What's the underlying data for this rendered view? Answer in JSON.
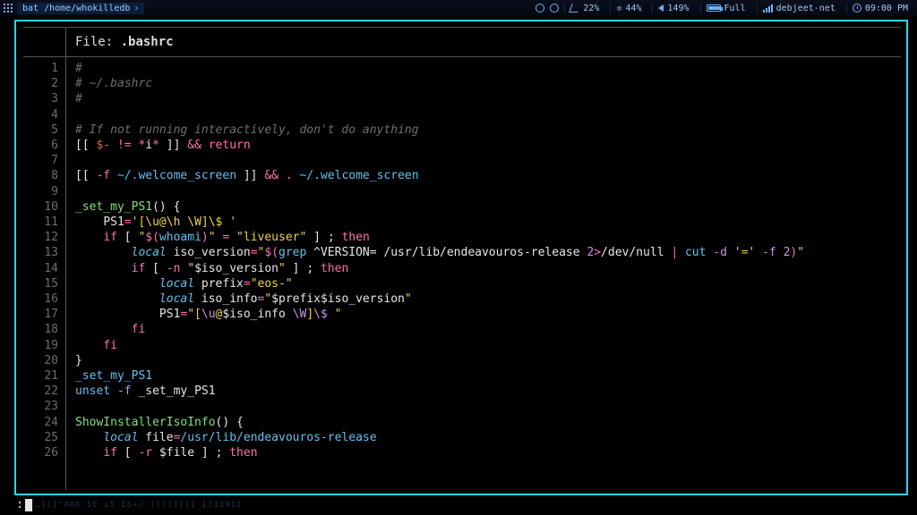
{
  "topbar": {
    "window_title": "bat /home/whokilledb",
    "cpu1": "22%",
    "cpu2": "44%",
    "volume": "149%",
    "battery_label": "Full",
    "battery_pct": 100,
    "network": "debjeet-net",
    "clock": "09:00 PM"
  },
  "viewer": {
    "file_label": "File:",
    "file_name": ".bashrc",
    "lines_start": 1,
    "lines_end": 26,
    "prompt_char": ":"
  },
  "code_lines": [
    {
      "n": 1,
      "segs": [
        [
          "#",
          "comment"
        ]
      ]
    },
    {
      "n": 2,
      "segs": [
        [
          "# ~/.bashrc",
          "comment"
        ]
      ]
    },
    {
      "n": 3,
      "segs": [
        [
          "#",
          "comment"
        ]
      ]
    },
    {
      "n": 4,
      "segs": [
        [
          "",
          "white"
        ]
      ]
    },
    {
      "n": 5,
      "segs": [
        [
          "# If not running interactively, don't do anything",
          "comment"
        ]
      ]
    },
    {
      "n": 6,
      "segs": [
        [
          "[[ ",
          "punct"
        ],
        [
          "$-",
          "param"
        ],
        [
          " != ",
          "op"
        ],
        [
          "*",
          "op"
        ],
        [
          "i",
          "white"
        ],
        [
          "*",
          "op"
        ],
        [
          " ]]",
          "punct"
        ],
        [
          " && ",
          "op"
        ],
        [
          "return",
          "kw"
        ]
      ]
    },
    {
      "n": 7,
      "segs": [
        [
          "",
          "white"
        ]
      ]
    },
    {
      "n": 8,
      "segs": [
        [
          "[[ ",
          "punct"
        ],
        [
          "-f",
          "op"
        ],
        [
          " ~/.welcome_screen ",
          "path"
        ],
        [
          "]]",
          "punct"
        ],
        [
          " && ",
          "op"
        ],
        [
          ". ",
          "kw"
        ],
        [
          "~/.welcome_screen",
          "path"
        ]
      ]
    },
    {
      "n": 9,
      "segs": [
        [
          "",
          "white"
        ]
      ]
    },
    {
      "n": 10,
      "segs": [
        [
          "_set_my_PS1",
          "fn"
        ],
        [
          "()",
          "punct"
        ],
        [
          " {",
          "punct"
        ]
      ]
    },
    {
      "n": 11,
      "segs": [
        [
          "    ",
          "white"
        ],
        [
          "PS1",
          "white"
        ],
        [
          "=",
          "eq"
        ],
        [
          "'[\\u@\\h \\W]\\$ '",
          "str"
        ]
      ]
    },
    {
      "n": 12,
      "segs": [
        [
          "    ",
          "white"
        ],
        [
          "if",
          "kw"
        ],
        [
          " [ ",
          "punct"
        ],
        [
          "\"",
          "str"
        ],
        [
          "$(",
          "op"
        ],
        [
          "whoami",
          "cmd"
        ],
        [
          ")",
          "op"
        ],
        [
          "\"",
          "str"
        ],
        [
          " = ",
          "op"
        ],
        [
          "\"liveuser\"",
          "str"
        ],
        [
          " ] ",
          "punct"
        ],
        [
          "; ",
          "white"
        ],
        [
          "then",
          "kw"
        ]
      ]
    },
    {
      "n": 13,
      "segs": [
        [
          "        ",
          "white"
        ],
        [
          "local",
          "builtin"
        ],
        [
          " iso_version",
          "white"
        ],
        [
          "=",
          "eq"
        ],
        [
          "\"",
          "str"
        ],
        [
          "$(",
          "op"
        ],
        [
          "grep",
          "cmd"
        ],
        [
          " ^VERSION= /usr/lib/endeavouros-release ",
          "white"
        ],
        [
          "2",
          "num"
        ],
        [
          ">",
          "op"
        ],
        [
          "/dev/null ",
          "white"
        ],
        [
          "| ",
          "op"
        ],
        [
          "cut",
          "cmd"
        ],
        [
          " -d",
          "flag"
        ],
        [
          " '='",
          "str"
        ],
        [
          " -f",
          "flag"
        ],
        [
          " 2",
          "num"
        ],
        [
          ")",
          "op"
        ],
        [
          "\"",
          "str"
        ]
      ]
    },
    {
      "n": 14,
      "segs": [
        [
          "        ",
          "white"
        ],
        [
          "if",
          "kw"
        ],
        [
          " [ ",
          "punct"
        ],
        [
          "-n",
          "op"
        ],
        [
          " \"",
          "str"
        ],
        [
          "$iso_version",
          "white"
        ],
        [
          "\"",
          "str"
        ],
        [
          " ] ",
          "punct"
        ],
        [
          "; ",
          "white"
        ],
        [
          "then",
          "kw"
        ]
      ]
    },
    {
      "n": 15,
      "segs": [
        [
          "            ",
          "white"
        ],
        [
          "local",
          "builtin"
        ],
        [
          " prefix",
          "white"
        ],
        [
          "=",
          "eq"
        ],
        [
          "\"eos-\"",
          "str"
        ]
      ]
    },
    {
      "n": 16,
      "segs": [
        [
          "            ",
          "white"
        ],
        [
          "local",
          "builtin"
        ],
        [
          " iso_info",
          "white"
        ],
        [
          "=",
          "eq"
        ],
        [
          "\"",
          "str"
        ],
        [
          "$prefix$iso_version",
          "white"
        ],
        [
          "\"",
          "str"
        ]
      ]
    },
    {
      "n": 17,
      "segs": [
        [
          "            ",
          "white"
        ],
        [
          "PS1",
          "white"
        ],
        [
          "=",
          "eq"
        ],
        [
          "\"[",
          "str"
        ],
        [
          "\\u",
          "esc"
        ],
        [
          "@",
          "str"
        ],
        [
          "$iso_info",
          "white"
        ],
        [
          " ",
          "str"
        ],
        [
          "\\W",
          "esc"
        ],
        [
          "]",
          "str"
        ],
        [
          "\\$",
          "esc"
        ],
        [
          " \"",
          "str"
        ]
      ]
    },
    {
      "n": 18,
      "segs": [
        [
          "        ",
          "white"
        ],
        [
          "fi",
          "kw"
        ]
      ]
    },
    {
      "n": 19,
      "segs": [
        [
          "    ",
          "white"
        ],
        [
          "fi",
          "kw"
        ]
      ]
    },
    {
      "n": 20,
      "segs": [
        [
          "}",
          "punct"
        ]
      ]
    },
    {
      "n": 21,
      "segs": [
        [
          "_set_my_PS1",
          "cmd"
        ]
      ]
    },
    {
      "n": 22,
      "segs": [
        [
          "unset",
          "cmd"
        ],
        [
          " -f",
          "flag"
        ],
        [
          " _set_my_PS1",
          "white"
        ]
      ]
    },
    {
      "n": 23,
      "segs": [
        [
          "",
          "white"
        ]
      ]
    },
    {
      "n": 24,
      "segs": [
        [
          "ShowInstallerIsoInfo",
          "fn"
        ],
        [
          "()",
          "punct"
        ],
        [
          " {",
          "punct"
        ]
      ]
    },
    {
      "n": 25,
      "segs": [
        [
          "    ",
          "white"
        ],
        [
          "local",
          "builtin"
        ],
        [
          " file",
          "white"
        ],
        [
          "=",
          "eq"
        ],
        [
          "/usr/lib/endeavouros-release",
          "path"
        ]
      ]
    },
    {
      "n": 26,
      "segs": [
        [
          "    ",
          "white"
        ],
        [
          "if",
          "kw"
        ],
        [
          " [ ",
          "punct"
        ],
        [
          "-r",
          "op"
        ],
        [
          " $file",
          "white"
        ],
        [
          " ] ",
          "punct"
        ],
        [
          "; ",
          "white"
        ],
        [
          "then",
          "kw"
        ]
      ]
    }
  ]
}
